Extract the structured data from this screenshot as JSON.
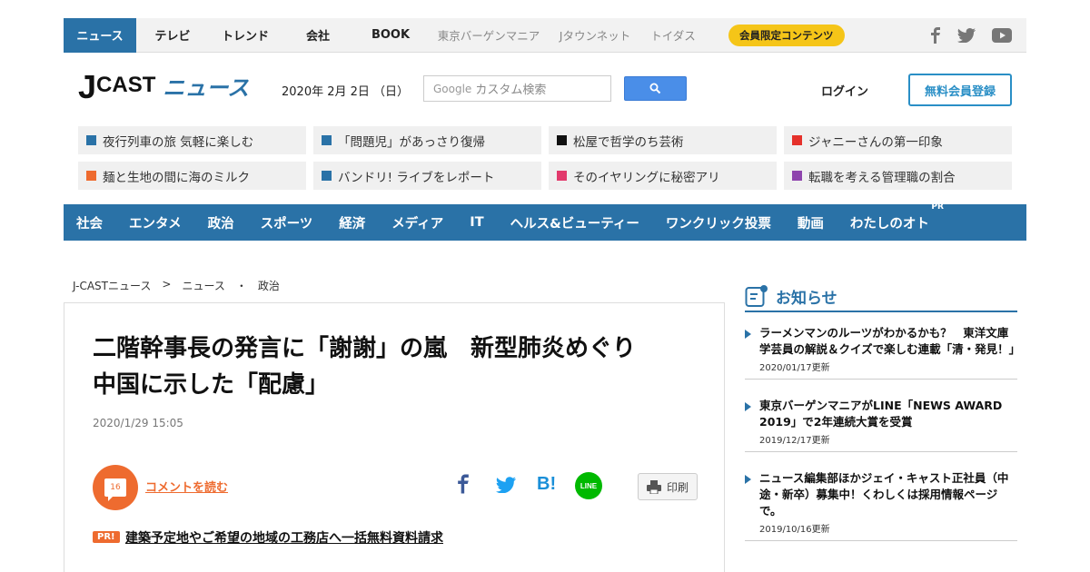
{
  "topbar": {
    "tabs": [
      {
        "label": "ニュース",
        "active": true
      },
      {
        "label": "テレビ"
      },
      {
        "label": "トレンド"
      },
      {
        "label": "会社"
      },
      {
        "label": "BOOK"
      }
    ],
    "sub_links": [
      "東京バーゲンマニア",
      "Jタウンネット",
      "トイダス"
    ],
    "member_badge": "会員限定コンテンツ",
    "social_icons": [
      "facebook-icon",
      "twitter-icon",
      "youtube-icon"
    ]
  },
  "header": {
    "logo_j": "J",
    "logo_cast": "CAST",
    "logo_news": "ニュース",
    "date": "2020年 2月 2日 （日）",
    "search_brand": "Google",
    "search_placeholder": "カスタム検索",
    "login": "ログイン",
    "register": "無料会員登録"
  },
  "trending": [
    {
      "label": "夜行列車の旅 気軽に楽しむ",
      "color": "#2a72a7"
    },
    {
      "label": "「問題児」があっさり復帰",
      "color": "#2a72a7"
    },
    {
      "label": "松屋で哲学のち芸術",
      "color": "#111111"
    },
    {
      "label": "ジャニーさんの第一印象",
      "color": "#e5312b"
    },
    {
      "label": "麺と生地の間に海のミルク",
      "color": "#ee6b2f"
    },
    {
      "label": "バンドリ! ライブをレポート",
      "color": "#2a72a7"
    },
    {
      "label": "そのイヤリングに秘密アリ",
      "color": "#e23a6c"
    },
    {
      "label": "転職を考える管理職の割合",
      "color": "#8e44ad"
    }
  ],
  "categories": [
    "社会",
    "エンタメ",
    "政治",
    "スポーツ",
    "経済",
    "メディア",
    "IT",
    "ヘルス&ビューティー",
    "ワンクリック投票",
    "動画",
    "わたしのオト"
  ],
  "category_pr": "PR",
  "breadcrumb": [
    "J-CASTニュース",
    ">",
    "ニュース",
    "・",
    "政治"
  ],
  "article": {
    "title_line1": "二階幹事長の発言に「謝謝」の嵐　新型肺炎めぐり",
    "title_line2": "中国に示した「配慮」",
    "date": "2020/1/29 15:05",
    "comment_count": "16",
    "comment_link": "コメントを読む",
    "share_icons": [
      "facebook-share-icon",
      "twitter-share-icon",
      "hatena-share-icon",
      "line-share-icon"
    ],
    "line_label": "LINE",
    "hatena_label": "B!",
    "print_label": "印刷",
    "pr_badge": "PR!",
    "pr_link": "建築予定地やご希望の地域の工務店へ一括無料資料請求"
  },
  "notices": {
    "heading": "お知らせ",
    "items": [
      {
        "text": "ラーメンマンのルーツがわかるかも？　東洋文庫学芸員の解説＆クイズで楽しむ連載「清・発見！」",
        "updated": "2020/01/17更新"
      },
      {
        "text": "東京バーゲンマニアがLINE「NEWS AWARD 2019」で2年連続大賞を受賞",
        "updated": "2019/12/17更新"
      },
      {
        "text": "ニュース編集部ほかジェイ・キャスト正社員（中途・新卒）募集中！くわしくは採用情報ページで。",
        "updated": "2019/10/16更新"
      }
    ]
  }
}
